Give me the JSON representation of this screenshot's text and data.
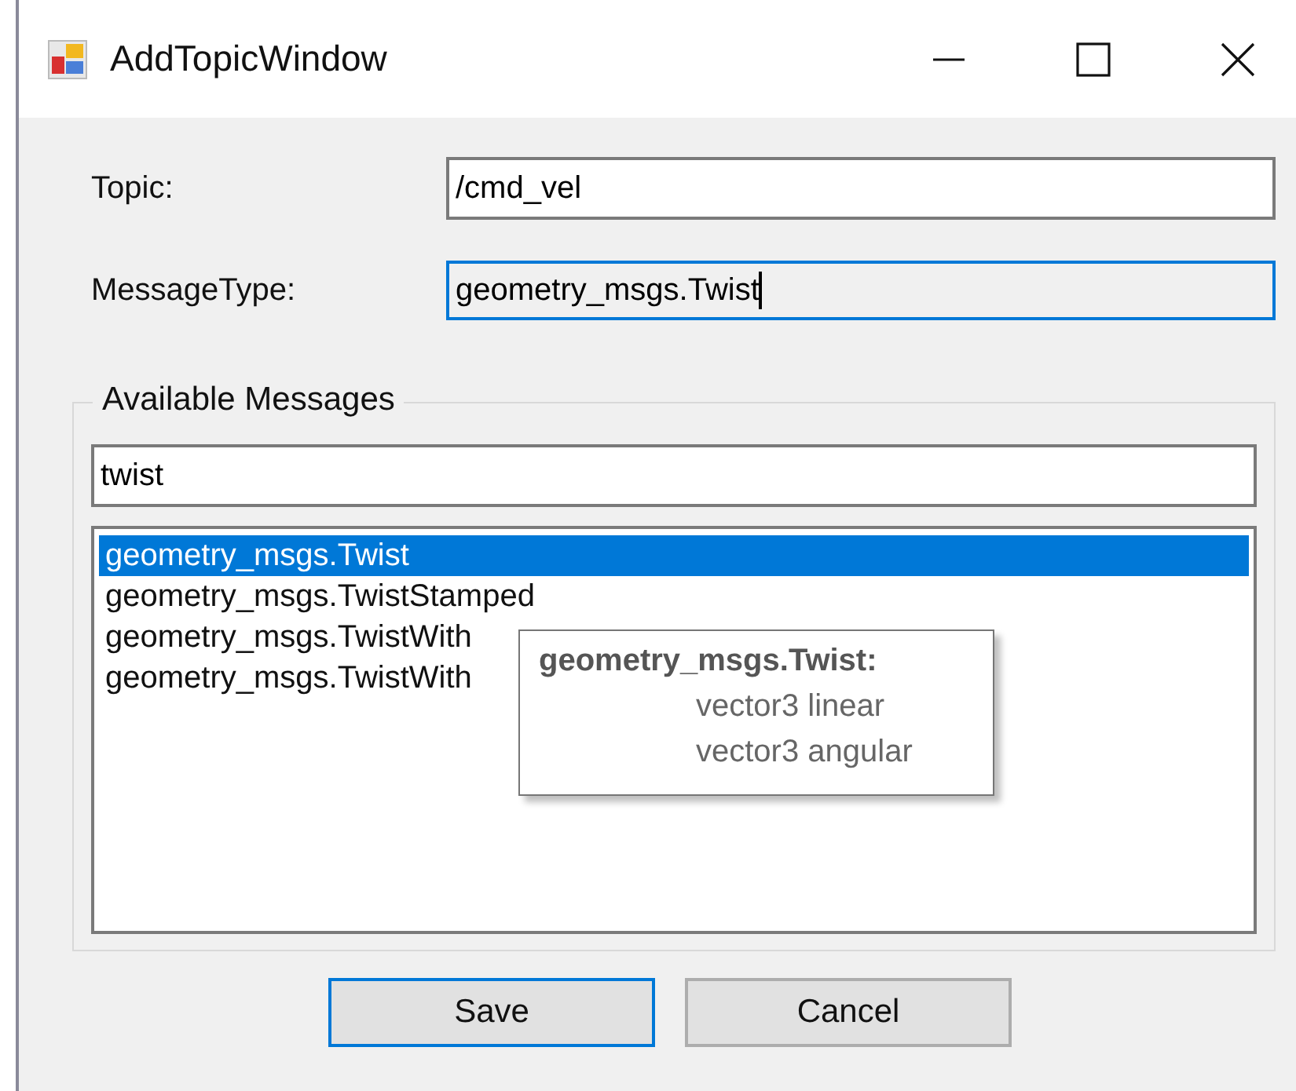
{
  "window": {
    "title": "AddTopicWindow"
  },
  "fields": [
    {
      "label": "Topic:",
      "value": "/cmd_vel",
      "focused": false
    },
    {
      "label": "MessageType:",
      "value": "geometry_msgs.Twist",
      "focused": true
    }
  ],
  "available_messages": {
    "title": "Available Messages",
    "search": {
      "value": "twist"
    },
    "items": [
      {
        "text": "geometry_msgs.Twist",
        "selected": true
      },
      {
        "text": "geometry_msgs.TwistStamped",
        "selected": false
      },
      {
        "text": "geometry_msgs.TwistWith",
        "selected": false
      },
      {
        "text": "geometry_msgs.TwistWith",
        "selected": false
      }
    ],
    "tooltip": {
      "title": "geometry_msgs.Twist:",
      "lines": [
        "vector3 linear",
        "vector3 angular"
      ]
    }
  },
  "buttons": [
    {
      "label": "Save",
      "default": true
    },
    {
      "label": "Cancel",
      "default": false
    }
  ]
}
